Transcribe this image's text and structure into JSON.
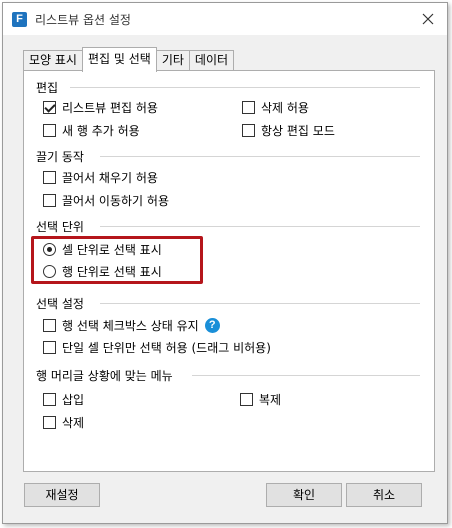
{
  "window": {
    "title": "리스트뷰 옵션 설정",
    "icon_letter": "F"
  },
  "tabs": [
    {
      "label": "모양 표시"
    },
    {
      "label": "편집 및 선택"
    },
    {
      "label": "기타"
    },
    {
      "label": "데이터"
    }
  ],
  "groups": {
    "edit": {
      "label": "편집",
      "options": [
        {
          "label": "리스트뷰 편집 허용",
          "checked": true
        },
        {
          "label": "삭제 허용",
          "checked": false
        },
        {
          "label": "새 행 추가 허용",
          "checked": false
        },
        {
          "label": "항상 편집 모드",
          "checked": false
        }
      ]
    },
    "drag": {
      "label": "끌기 동작",
      "options": [
        {
          "label": "끌어서 채우기 허용",
          "checked": false
        },
        {
          "label": "끌어서 이동하기 허용",
          "checked": false
        }
      ]
    },
    "select_unit": {
      "label": "선택 단위",
      "options": [
        {
          "label": "셀 단위로 선택 표시",
          "selected": true
        },
        {
          "label": "행 단위로 선택 표시",
          "selected": false
        }
      ]
    },
    "select_settings": {
      "label": "선택 설정",
      "options": [
        {
          "label": "행 선택 체크박스 상태 유지",
          "checked": false
        },
        {
          "label": "단일 셀 단위만 선택 허용 (드래그 비허용)",
          "checked": false
        }
      ]
    },
    "context_menu": {
      "label": "행 머리글 상황에 맞는 메뉴",
      "options": [
        {
          "label": "삽입",
          "checked": false
        },
        {
          "label": "복제",
          "checked": false
        },
        {
          "label": "삭제",
          "checked": false
        }
      ]
    }
  },
  "buttons": {
    "reset": "재설정",
    "ok": "확인",
    "cancel": "취소"
  },
  "colors": {
    "highlight": "#b5151b",
    "accent": "#1a8fd8"
  }
}
